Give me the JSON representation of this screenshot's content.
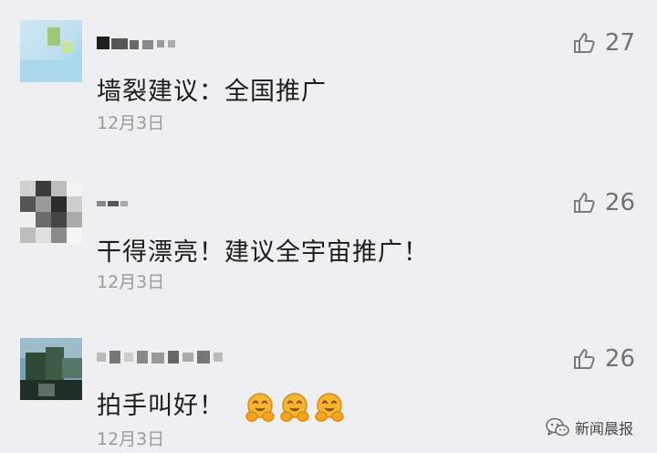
{
  "comments": [
    {
      "text": "墙裂建议：全国推广",
      "date": "12月3日",
      "likes": "27"
    },
    {
      "text": "干得漂亮！建议全宇宙推广！",
      "date": "12月3日",
      "likes": "26"
    },
    {
      "text": "拍手叫好！",
      "date": "12月3日",
      "likes": "26",
      "emoji_count": 3,
      "emoji_icon": "hugging-face-icon"
    }
  ],
  "watermark": {
    "label": "新闻晨报",
    "icon": "wechat-icon"
  },
  "colors": {
    "background": "#efeff2",
    "text": "#1c1c1c",
    "date": "#9a9a9a",
    "like_count": "#727272"
  }
}
